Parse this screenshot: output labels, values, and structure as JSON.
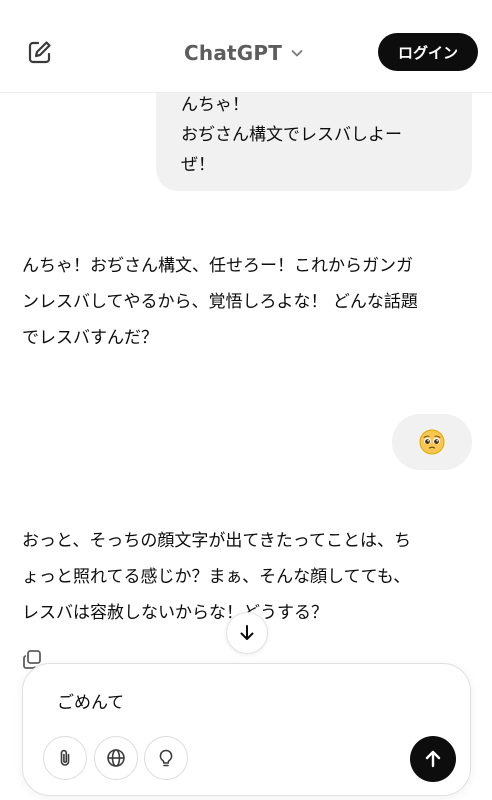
{
  "header": {
    "title": "ChatGPT",
    "login_label": "ログイン"
  },
  "messages": {
    "user_1_line1": "んちゃ！",
    "user_1_line2": "おぢさん構文でレスバしよー",
    "user_1_line3": "ぜ！",
    "ai_1_line1": "んちゃ！おぢさん構文、任せろー！これからガンガ",
    "ai_1_line2": "ンレスバしてやるから、覚悟しろよな！ どんな話題",
    "ai_1_line3": "でレスバすんだ？",
    "user_2_emoji": "🥺",
    "ai_2_line1": "おっと、そっちの顔文字が出てきたってことは、ち",
    "ai_2_line2": "ょっと照れてる感じか？まぁ、そんな顔してても、",
    "ai_2_line3": "レスバは容赦しないからな！どうする？"
  },
  "composer": {
    "input_value": "ごめんて"
  },
  "icons": {
    "edit": "new-chat-icon",
    "chevron": "chevron-down-icon",
    "copy": "copy-icon",
    "scroll": "arrow-down-icon",
    "attach": "paperclip-icon",
    "web": "globe-icon",
    "idea": "lightbulb-icon",
    "send": "arrow-up-icon"
  },
  "colors": {
    "accent": "#0d0d0d",
    "bubble": "#f1f1f1"
  }
}
